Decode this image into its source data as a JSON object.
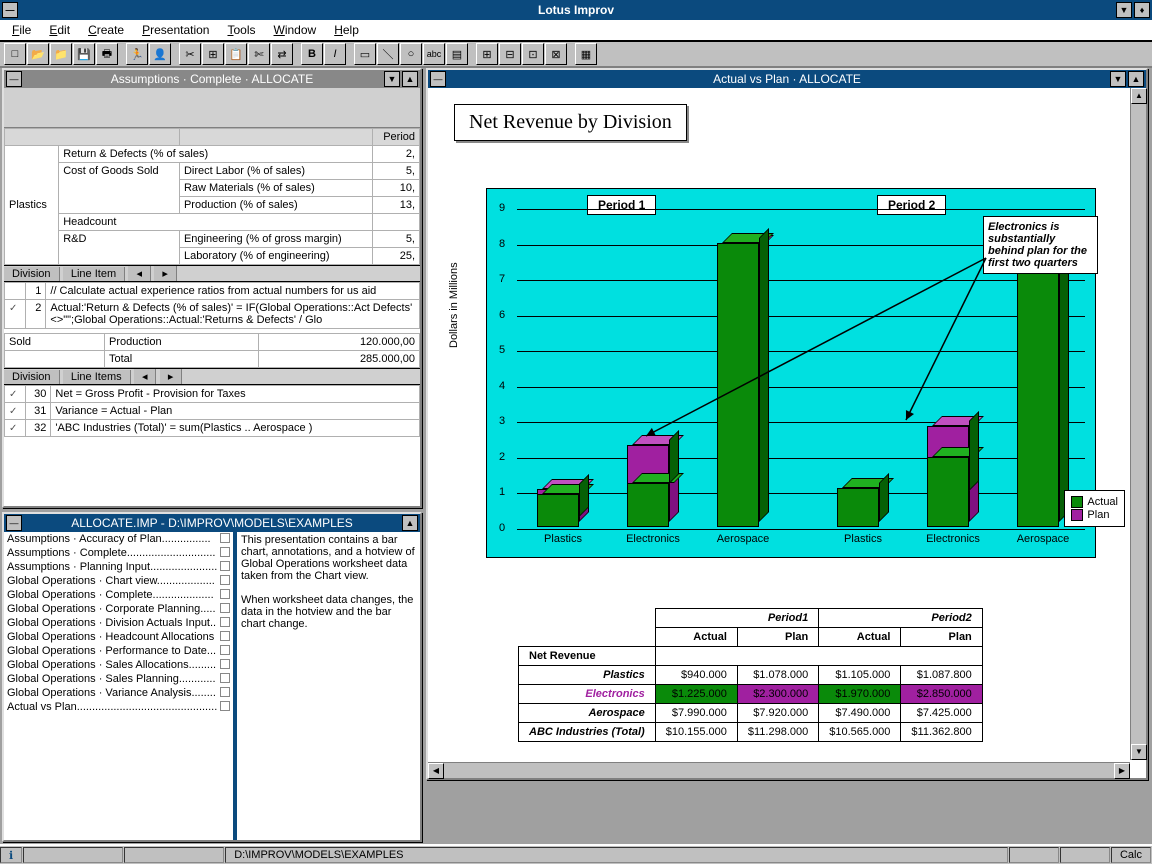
{
  "app_title": "Lotus Improv",
  "menus": [
    "File",
    "Edit",
    "Create",
    "Presentation",
    "Tools",
    "Window",
    "Help"
  ],
  "toolbar_icons": [
    "new",
    "open",
    "save",
    "print",
    "|",
    "run",
    "person",
    "|",
    "cut",
    "copy",
    "paste",
    "scissors",
    "swap",
    "|",
    "bold",
    "italic",
    "|",
    "rect",
    "line",
    "oval",
    "abc",
    "aligner",
    "|",
    "tile1",
    "tile2",
    "tile3",
    "tile4",
    "|",
    "grid"
  ],
  "status_path": "D:\\IMPROV\\MODELS\\EXAMPLES",
  "status_right": "Calc",
  "win_assumptions": {
    "title": "Assumptions · Complete · ALLOCATE",
    "col_header": "Period",
    "col_val": "2,",
    "category_col": "Plastics",
    "rows": [
      {
        "group": "",
        "label": "Return & Defects (% of sales)",
        "val": "2,"
      },
      {
        "group": "Cost of Goods Sold",
        "label": "Direct Labor (% of sales)",
        "val": "5,"
      },
      {
        "group": "",
        "label": "Raw Materials (% of sales)",
        "val": "10,"
      },
      {
        "group": "",
        "label": "Production (% of sales)",
        "val": "13,"
      },
      {
        "group": "Headcount",
        "label": "",
        "val": ""
      },
      {
        "group": "R&D",
        "label": "Engineering (% of gross margin)",
        "val": "5,"
      },
      {
        "group": "",
        "label": "Laboratory (% of engineering)",
        "val": "25,"
      }
    ],
    "dim_labels1": [
      "Division",
      "Line Item",
      "◂",
      "▸"
    ],
    "formula_rows": [
      {
        "n": "1",
        "txt": "// Calculate actual experience ratios from actual numbers for us aid"
      },
      {
        "n": "2",
        "chk": true,
        "txt": "Actual:'Return & Defects (% of sales)' = IF(Global Operations::Act Defects' <>\"\";Global Operations::Actual:'Returns & Defects' / Glo"
      }
    ],
    "mid_rows": [
      {
        "a": "Sold",
        "b": "Production",
        "c": "120.000,00"
      },
      {
        "a": "",
        "b": "Total",
        "c": "285.000,00"
      }
    ],
    "dim_labels2": [
      "Division",
      "Line Items",
      "◂",
      "▸"
    ],
    "bottom_rows": [
      {
        "n": "30",
        "chk": true,
        "txt": "Net = Gross Profit - Provision for Taxes"
      },
      {
        "n": "31",
        "chk": true,
        "txt": "Variance = Actual - Plan"
      },
      {
        "n": "32",
        "chk": true,
        "txt": "'ABC Industries (Total)' = sum(Plastics .. Aerospace )"
      }
    ]
  },
  "win_browser": {
    "title": "ALLOCATE.IMP - D:\\IMPROV\\MODELS\\EXAMPLES",
    "left_items": [
      "Assumptions · Accuracy of Plan................",
      "Assumptions · Complete.............................",
      "Assumptions · Planning Input......................",
      "Global Operations · Chart view...................",
      "Global Operations · Complete....................",
      "Global Operations · Corporate Planning.....",
      "Global Operations · Division Actuals Input..",
      "Global Operations · Headcount Allocations",
      "Global Operations · Performance to Date...",
      "Global Operations · Sales Allocations.........",
      "Global Operations · Sales Planning............",
      "Global Operations · Variance Analysis........",
      "Actual vs Plan.............................................."
    ],
    "right_text": "This presentation contains a bar chart, annotations, and a hotview of Global Operations worksheet data taken from the Chart view.\n\nWhen worksheet data changes, the data in the hotview and the bar chart change."
  },
  "win_chart": {
    "title": "Actual vs Plan · ALLOCATE",
    "chart_title": "Net Revenue by Division",
    "ylabel": "Dollars in Millions",
    "period_labels": [
      "Period 1",
      "Period 2"
    ],
    "categories": [
      "Plastics",
      "Electronics",
      "Aerospace",
      "Plastics",
      "Electronics",
      "Aerospace"
    ],
    "legend": [
      "Actual",
      "Plan"
    ],
    "annotation": "Electronics is substantially behind plan for the first two quarters",
    "y_ticks": [
      0,
      1,
      2,
      3,
      4,
      5,
      6,
      7,
      8,
      9
    ]
  },
  "chart_data": {
    "type": "bar",
    "title": "Net Revenue by Division",
    "ylabel": "Dollars in Millions",
    "ylim": [
      0,
      9
    ],
    "groups": [
      "Period 1",
      "Period 2"
    ],
    "categories": [
      "Plastics",
      "Electronics",
      "Aerospace"
    ],
    "series": [
      {
        "name": "Actual",
        "color": "#0a8a0a",
        "values_period1": [
          0.94,
          1.225,
          7.99
        ],
        "values_period2": [
          1.105,
          1.97,
          7.49
        ]
      },
      {
        "name": "Plan",
        "color": "#a020a0",
        "values_period1": [
          1.078,
          2.3,
          7.92
        ],
        "values_period2": [
          1.088,
          2.85,
          7.425
        ]
      }
    ],
    "annotation": "Electronics is substantially behind plan for the first two quarters"
  },
  "data_table": {
    "header_groups": [
      "Period1",
      "Period2"
    ],
    "header_cols": [
      "Actual",
      "Plan",
      "Actual",
      "Plan"
    ],
    "section": "Net Revenue",
    "rows": [
      {
        "label": "Plastics",
        "vals": [
          "$940.000",
          "$1.078.000",
          "$1.105.000",
          "$1.087.800"
        ]
      },
      {
        "label": "Electronics",
        "highlight": true,
        "vals": [
          "$1.225.000",
          "$2.300.000",
          "$1.970.000",
          "$2.850.000"
        ]
      },
      {
        "label": "Aerospace",
        "vals": [
          "$7.990.000",
          "$7.920.000",
          "$7.490.000",
          "$7.425.000"
        ]
      },
      {
        "label": "ABC Industries (Total)",
        "vals": [
          "$10.155.000",
          "$11.298.000",
          "$10.565.000",
          "$11.362.800"
        ]
      }
    ]
  }
}
